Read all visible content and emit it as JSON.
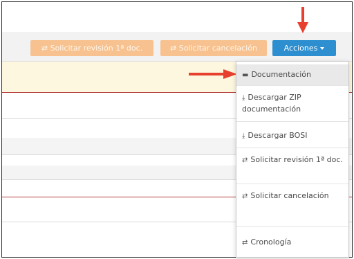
{
  "toolbar": {
    "btn_revision": "⇄ Solicitar revisión 1ª doc.",
    "btn_cancel": "⇄ Solicitar cancelación",
    "btn_actions": "Acciones"
  },
  "menu": {
    "items": [
      {
        "icon": "▬",
        "label": "Documentación"
      },
      {
        "icon": "⤓",
        "label": "Descargar ZIP documentación"
      },
      {
        "icon": "⤓",
        "label": "Descargar BOSI"
      },
      {
        "icon": "⇄",
        "label": "Solicitar revisión 1ª doc."
      },
      {
        "icon": "⇄",
        "label": "Solicitar cancelación"
      },
      {
        "icon": "⇄",
        "label": "Cronología"
      }
    ]
  },
  "colors": {
    "accent": "#2d8fcf",
    "orange": "#f7c28f",
    "highlight_bg": "#fdf7df",
    "arrow_red": "#e8402e"
  }
}
